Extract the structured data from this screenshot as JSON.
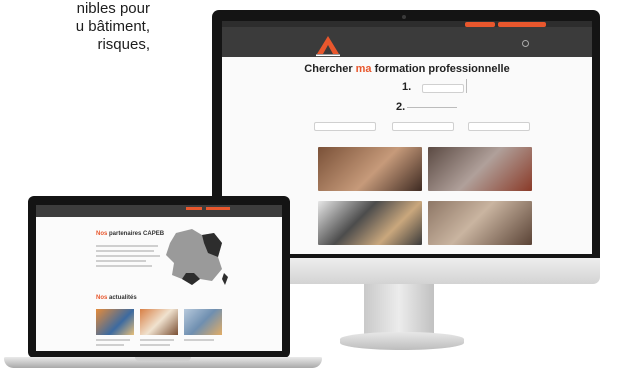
{
  "intro": {
    "lines": [
      "nibles pour",
      "u bâtiment,",
      "risques,"
    ]
  },
  "desktop": {
    "top_buttons": [
      "",
      ""
    ],
    "title_prefix": "Chercher ",
    "title_accent": "ma",
    "title_suffix": " formation professionnelle",
    "step1": "1.",
    "step2": "2.",
    "cards": [
      {
        "caption": ""
      },
      {
        "caption": ""
      },
      {
        "caption": ""
      },
      {
        "caption": ""
      }
    ]
  },
  "laptop": {
    "section1_accent": "Nos",
    "section1_title": " partenaires CAPEB",
    "section2_accent": "Nos",
    "section2_title": " actualités"
  },
  "colors": {
    "accent": "#e8572d",
    "nav": "#3b3b3b"
  }
}
